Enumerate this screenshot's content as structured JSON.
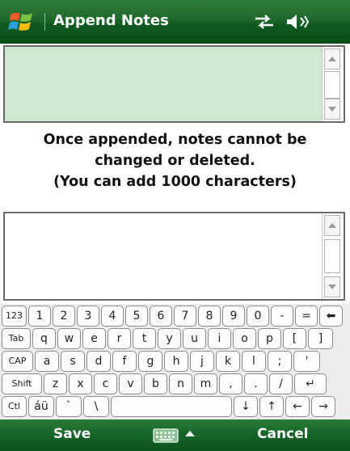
{
  "window": {
    "title": "Append Notes"
  },
  "icons": {
    "start": "windows-flag-icon",
    "connectivity": "connectivity-icon",
    "volume": "speaker-icon",
    "keyboard": "keyboard-icon",
    "sip_toggle": "chevron-up-icon",
    "backspace": "backspace-icon",
    "enter": "enter-icon",
    "up": "arrow-up-icon",
    "down": "arrow-down-icon",
    "left": "arrow-left-icon",
    "right": "arrow-right-icon"
  },
  "notes": {
    "existing_value": "",
    "new_value": ""
  },
  "notice": {
    "line1": "Once appended, notes cannot be",
    "line2": "changed or deleted.",
    "line3": "(You can add 1000 characters)"
  },
  "keyboard": {
    "rows": [
      [
        "123",
        "1",
        "2",
        "3",
        "4",
        "5",
        "6",
        "7",
        "8",
        "9",
        "0",
        "-",
        "=",
        "⬅"
      ],
      [
        "Tab",
        "q",
        "w",
        "e",
        "r",
        "t",
        "y",
        "u",
        "i",
        "o",
        "p",
        "[",
        "]"
      ],
      [
        "CAP",
        "a",
        "s",
        "d",
        "f",
        "g",
        "h",
        "j",
        "k",
        "l",
        ";",
        "'"
      ],
      [
        "Shift",
        "z",
        "x",
        "c",
        "v",
        "b",
        "n",
        "m",
        ",",
        ".",
        "/",
        "↵"
      ],
      [
        "Ctl",
        "áü",
        "`",
        "\\",
        "",
        "↓",
        "↑",
        "←",
        "→"
      ]
    ]
  },
  "menu": {
    "left": "Save",
    "right": "Cancel"
  },
  "colors": {
    "title_bar": "#1e6a2d",
    "menu_bar": "#166428",
    "notes_bg": "#cfe8cf",
    "keyboard_bg": "#ececec"
  }
}
